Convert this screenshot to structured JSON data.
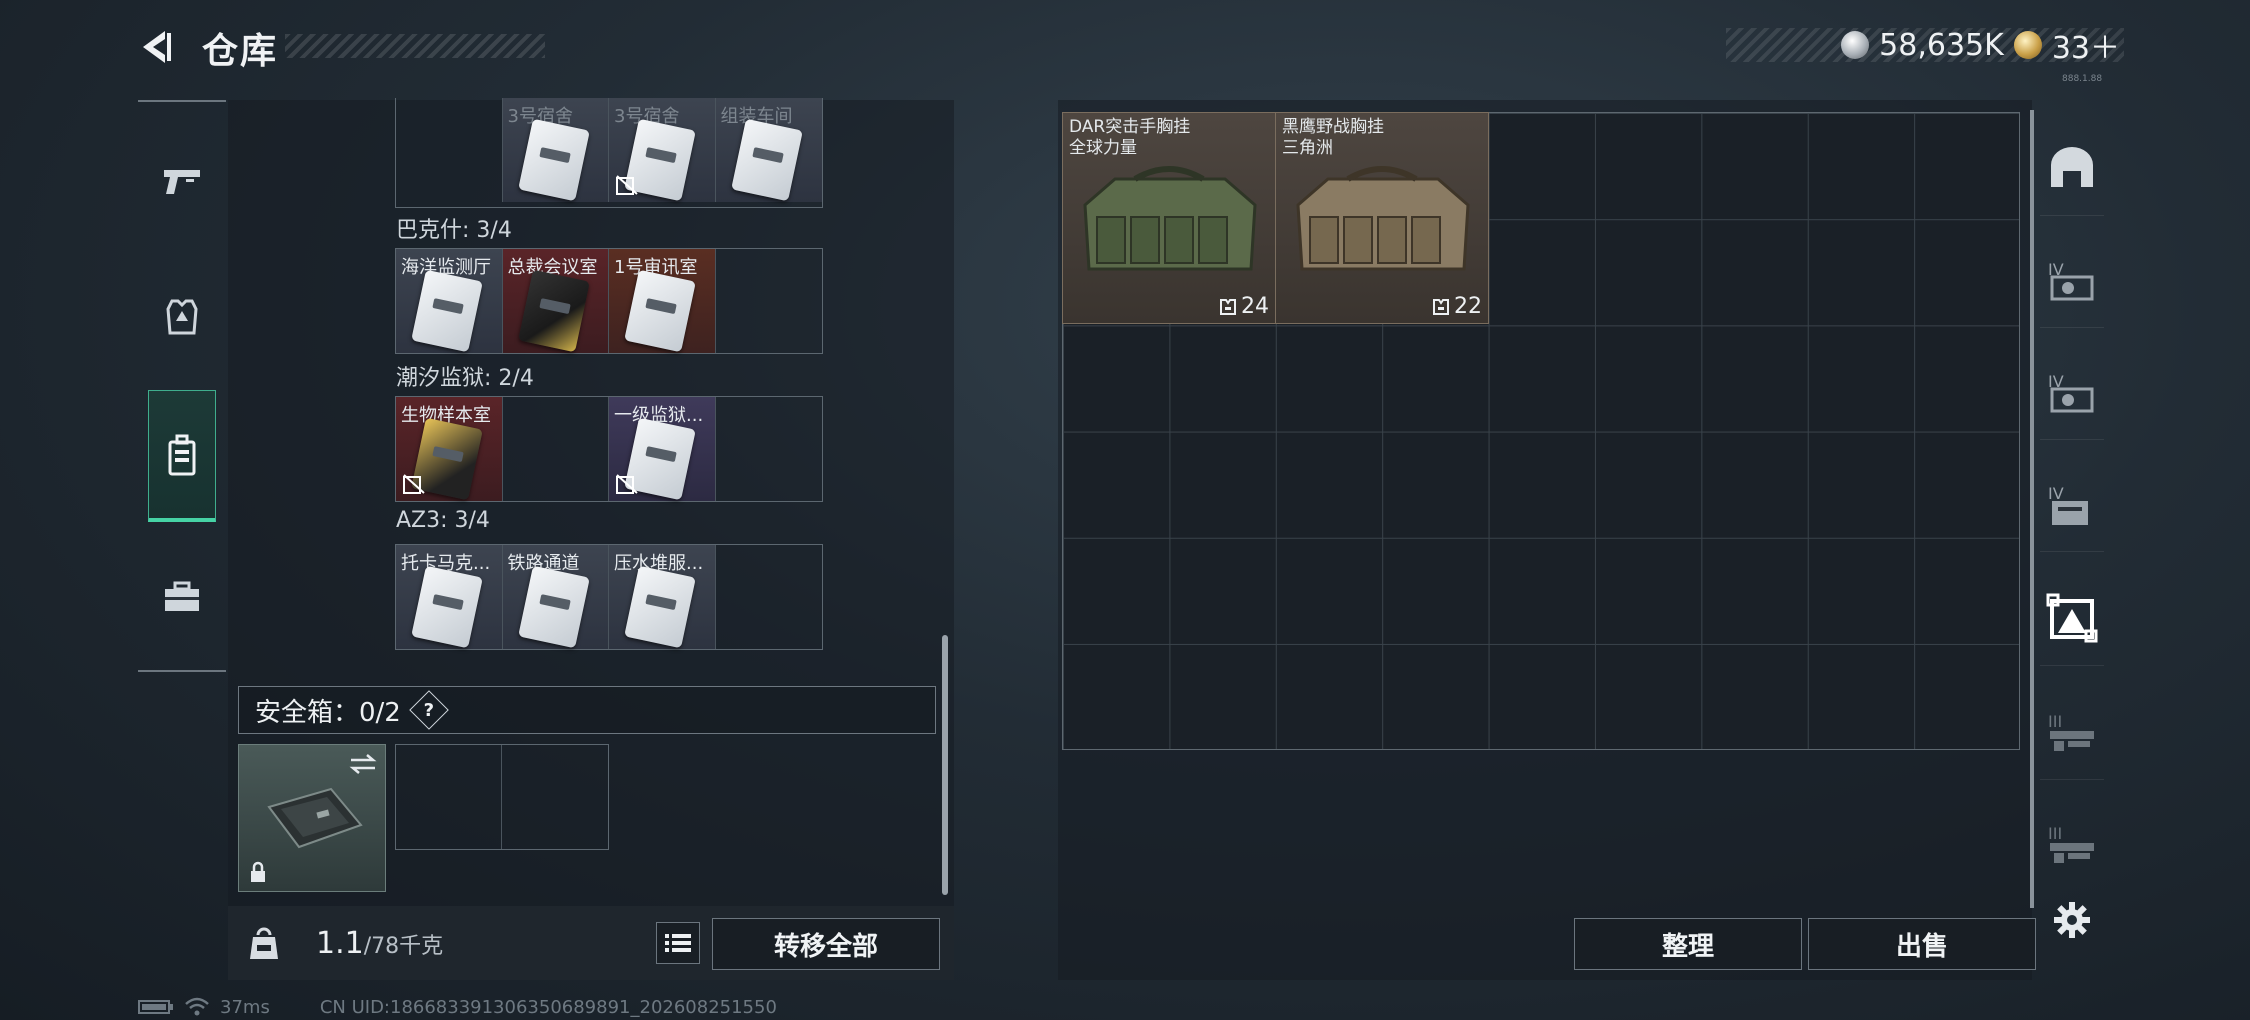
{
  "header": {
    "title": "仓库",
    "currency_silver": "58,635K",
    "currency_gold": "33＋",
    "version_tiny": "888.1.88"
  },
  "left_nav": {
    "items": [
      {
        "icon": "pistol-icon"
      },
      {
        "icon": "armor-icon"
      },
      {
        "icon": "keycard-case-icon",
        "active": true
      },
      {
        "icon": "toolbox-icon"
      }
    ]
  },
  "keycards": {
    "row0": {
      "slots": [
        {
          "name": "",
          "empty": true
        },
        {
          "name": "3号宿舍",
          "dim": true
        },
        {
          "name": "3号宿舍",
          "dim": true,
          "nosell": true
        },
        {
          "name": "组装车间",
          "dim": true
        }
      ]
    },
    "groups": [
      {
        "label": "巴克什: 3/4",
        "slots": [
          {
            "name": "海洋监测厅"
          },
          {
            "name": "总裁会议室"
          },
          {
            "name": "1号审讯室"
          },
          {
            "name": "",
            "empty": true
          }
        ]
      },
      {
        "label": "潮汐监狱: 2/4",
        "slots": [
          {
            "name": "生物样本室",
            "nosell": true
          },
          {
            "name": "",
            "empty": true
          },
          {
            "name": "一级监狱...",
            "nosell": true
          },
          {
            "name": "",
            "empty": true
          }
        ]
      },
      {
        "label": "AZ3: 3/4",
        "slots": [
          {
            "name": "托卡马克..."
          },
          {
            "name": "铁路通道"
          },
          {
            "name": "压水堆服..."
          },
          {
            "name": "",
            "empty": true
          }
        ]
      }
    ]
  },
  "safe": {
    "label": "安全箱：0/2",
    "help": "?"
  },
  "weight": {
    "current": "1.1",
    "max": "/78千克"
  },
  "buttons": {
    "transfer_all": "转移全部",
    "sort": "整理",
    "sell": "出售"
  },
  "items": [
    {
      "name_line1": "DAR突击手胸挂",
      "name_line2": "全球力量",
      "durability": "24",
      "color": "#5b6a4a"
    },
    {
      "name_line1": "黑鹰野战胸挂",
      "name_line2": "三角洲",
      "durability": "22",
      "color": "#8a7b63"
    }
  ],
  "right_nav": {
    "items": [
      {
        "icon": "helmet-slot-icon"
      },
      {
        "icon": "case-iv-icon-1"
      },
      {
        "icon": "case-iv-icon-2"
      },
      {
        "icon": "case-iv-icon-3"
      },
      {
        "icon": "vest-selected-icon",
        "active": true
      },
      {
        "icon": "rig-iii-icon-1"
      },
      {
        "icon": "rig-iii-icon-2"
      }
    ]
  },
  "footer": {
    "ping": "37ms",
    "uid": "CN UID:1866833913063506898​91_202608251550"
  }
}
